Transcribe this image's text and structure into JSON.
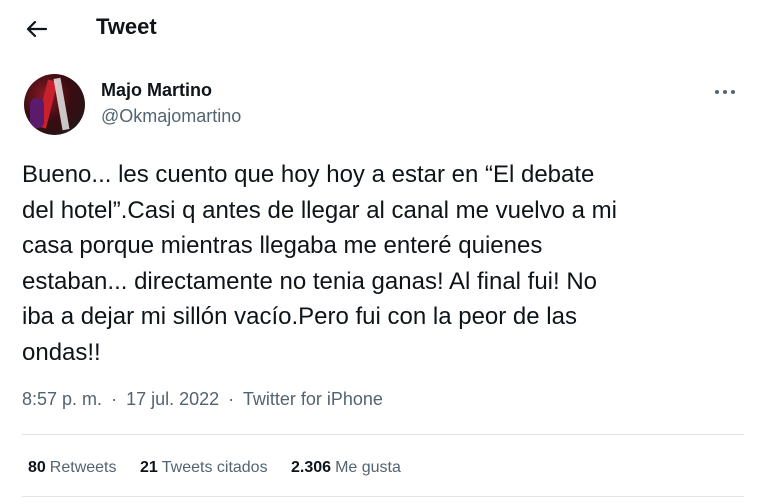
{
  "header": {
    "back_icon": "arrow-left-icon",
    "title": "Tweet"
  },
  "author": {
    "name": "Majo Martino",
    "handle": "@Okmajomartino",
    "more_icon": "more-horizontal-icon"
  },
  "tweet": {
    "text": "Bueno... les cuento que hoy hoy a estar en “El debate\ndel hotel”.Casi q antes de llegar al canal me vuelvo a mi\ncasa porque mientras llegaba me enteré quienes\nestaban... directamente no tenia ganas! Al final fui! No\niba a dejar mi sillón vacío.Pero fui con la peor de las\nondas!!",
    "time": "8:57 p. m.",
    "separator": "·",
    "date": "17 jul. 2022",
    "source": "Twitter for iPhone"
  },
  "stats": {
    "retweets_count": "80",
    "retweets_label": "Retweets",
    "quotes_count": "21",
    "quotes_label": "Tweets citados",
    "likes_count": "2.306",
    "likes_label": "Me gusta"
  },
  "colors": {
    "text_primary": "#0f1419",
    "text_secondary": "#536471",
    "divider": "#dfe4e8",
    "background": "#ffffff"
  }
}
